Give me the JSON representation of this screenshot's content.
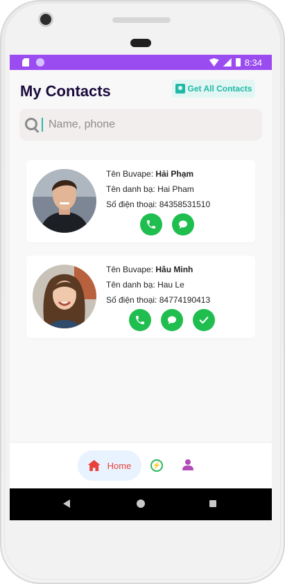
{
  "statusbar": {
    "time": "8:34",
    "color": "#9b4cf0"
  },
  "header": {
    "title": "My Contacts",
    "get_all_label": "Get All Contacts"
  },
  "search": {
    "placeholder": "Name, phone",
    "value": ""
  },
  "contacts": [
    {
      "buvape_label": "Tên Buvape:",
      "buvape_name": "Hải Phạm",
      "contact_label": "Tên danh bạ:",
      "contact_name": "Hai Pham",
      "phone_label": "Số điện thoại:",
      "phone": "84358531510",
      "actions": [
        "phone-icon",
        "message-icon"
      ]
    },
    {
      "buvape_label": "Tên Buvape:",
      "buvape_name": "Hâu Minh",
      "contact_label": "Tên danh bạ:",
      "contact_name": "Hau Le",
      "phone_label": "Số điện thoại:",
      "phone": "84774190413",
      "actions": [
        "phone-icon",
        "message-icon",
        "check-icon"
      ]
    }
  ],
  "bottom_nav": {
    "home_label": "Home",
    "active": "home"
  },
  "colors": {
    "accent": "#1fb9a6",
    "action_green": "#1fbe4f",
    "home_red": "#e8423b",
    "person_purple": "#b24ab7"
  }
}
